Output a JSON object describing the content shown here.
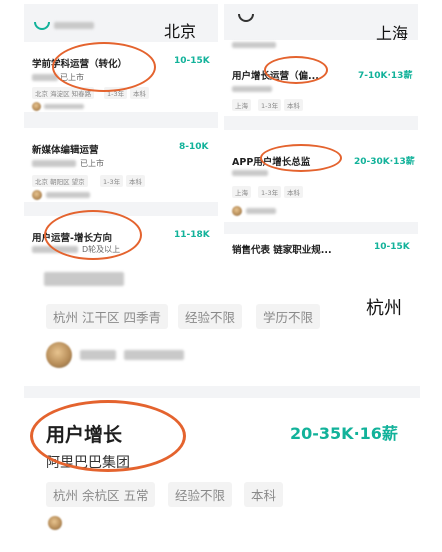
{
  "beijing": {
    "city_label": "北京",
    "jobs": [
      {
        "title": "学前学科运营（转化）",
        "salary": "10-15K",
        "company_status": "已上市",
        "tags": [
          "北京 海淀区 知春路",
          "1-3年",
          "本科"
        ]
      },
      {
        "title": "新媒体编辑运营",
        "salary": "8-10K",
        "company_status": "已上市",
        "tags": [
          "北京 朝阳区 望京",
          "1-3年",
          "本科"
        ]
      },
      {
        "title": "用户运营-增长方向",
        "salary": "11-18K",
        "company_status": "D轮及以上"
      }
    ]
  },
  "shanghai": {
    "city_label": "上海",
    "jobs": [
      {
        "title": "用户增长运营（偏...",
        "salary": "7-10K·13薪",
        "tags": [
          "上海",
          "1-3年",
          "本科"
        ]
      },
      {
        "title": "APP用户增长总监",
        "salary": "20-30K·13薪",
        "tags": [
          "上海",
          "1-3年",
          "本科"
        ]
      },
      {
        "title": "销售代表 链家职业规...",
        "salary": "10-15K"
      }
    ]
  },
  "hangzhou": {
    "city_label": "杭州",
    "top_tags": [
      "杭州 江干区 四季青",
      "经验不限",
      "学历不限"
    ],
    "job": {
      "title": "用户增长",
      "salary": "20-35K·16薪",
      "company": "阿里巴巴集团",
      "tags": [
        "杭州 余杭区 五常",
        "经验不限",
        "本科"
      ]
    }
  },
  "colors": {
    "accent": "#12b29a",
    "highlight_circle": "#e4632e"
  }
}
